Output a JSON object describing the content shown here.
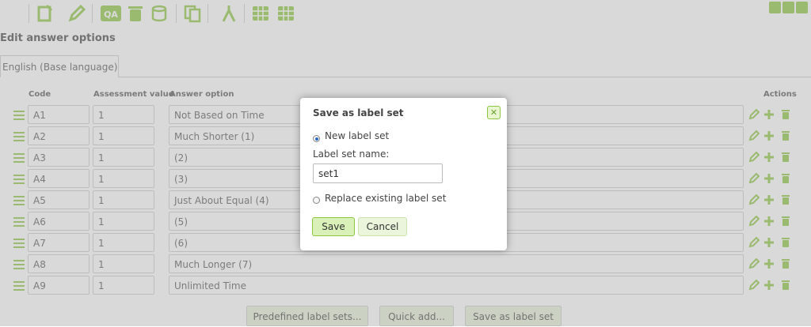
{
  "toolbar": {
    "icons": [
      "question-settings-icon",
      "edit-pencil-icon",
      "qa-icon",
      "delete-trash-icon",
      "database-icon",
      "copy-icon",
      "conditions-icon",
      "grid-icon",
      "grid-icon-2"
    ]
  },
  "window_controls": [
    "minimize-icon",
    "restore-icon",
    "close-icon"
  ],
  "page": {
    "title": "Edit answer options",
    "language_tab": "English (Base language)",
    "columns": {
      "code": "Code",
      "assessment": "Assessment value",
      "answer": "Answer option",
      "actions": "Actions"
    }
  },
  "rows": [
    {
      "code": "A1",
      "assessment": "1",
      "answer": "Not Based on Time"
    },
    {
      "code": "A2",
      "assessment": "1",
      "answer": "Much Shorter (1)"
    },
    {
      "code": "A3",
      "assessment": "1",
      "answer": "(2)"
    },
    {
      "code": "A4",
      "assessment": "1",
      "answer": "(3)"
    },
    {
      "code": "A5",
      "assessment": "1",
      "answer": "Just About Equal (4)"
    },
    {
      "code": "A6",
      "assessment": "1",
      "answer": "(5)"
    },
    {
      "code": "A7",
      "assessment": "1",
      "answer": "(6)"
    },
    {
      "code": "A8",
      "assessment": "1",
      "answer": "Much Longer (7)"
    },
    {
      "code": "A9",
      "assessment": "1",
      "answer": "Unlimited Time"
    }
  ],
  "bottom_buttons": {
    "predefined": "Predefined label sets...",
    "quick_add": "Quick add...",
    "save_as": "Save as label set"
  },
  "dialog": {
    "title": "Save as label set",
    "option_new": "New label set",
    "name_label": "Label set name:",
    "name_value": "set1",
    "option_replace": "Replace existing label set",
    "selected_option": "New label set",
    "save_button": "Save",
    "cancel_button": "Cancel"
  },
  "colors": {
    "accent": "#8dc63f",
    "overlay": "#aaaaaa"
  }
}
